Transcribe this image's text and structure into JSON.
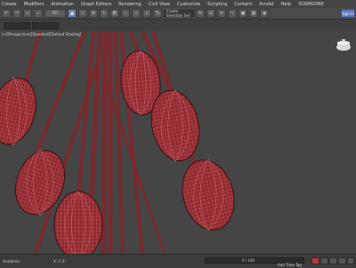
{
  "menu": [
    "Create",
    "Modifiers",
    "Animation",
    "Graph Editors",
    "Rendering",
    "Civil View",
    "Customize",
    "Scripting",
    "Content",
    "Arnold",
    "Help",
    "3DSMOORE"
  ],
  "toolbar": {
    "selection_filter": "All",
    "named_selection_placeholder": "Create Selection Set",
    "signin_label": "Sign In"
  },
  "viewport": {
    "label": "[+][Perspective][Standard][Default Shading]"
  },
  "status": {
    "left_text": "Academic",
    "frame_readout": "0 / 100",
    "addtime_label": "Add Time Tag",
    "coords": "X:  Y:  Z:"
  },
  "colors": {
    "bud_fill": "#8e2b30",
    "bud_wire": "#d9626a",
    "stem": "#7a2a2e",
    "viewport_bg": "#454545"
  },
  "icons": [
    "undo-icon",
    "redo-icon",
    "link-icon",
    "unlink-icon",
    "select-icon",
    "move-icon",
    "rotate-icon",
    "scale-icon",
    "snap-icon",
    "mirror-icon",
    "render-icon",
    "teapot-icon"
  ]
}
